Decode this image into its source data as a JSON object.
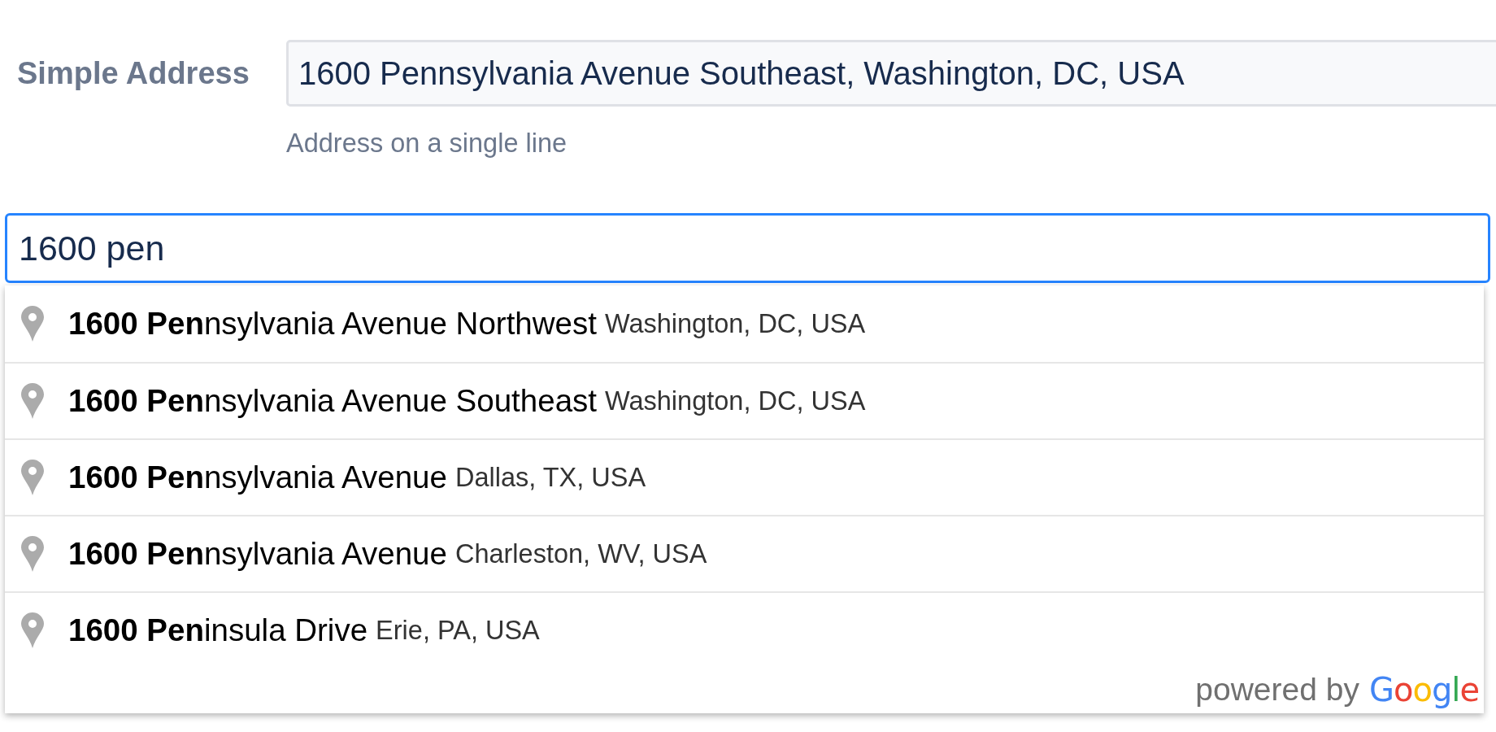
{
  "form": {
    "label": "Simple Address",
    "value": "1600 Pennsylvania Avenue Southeast, Washington, DC, USA",
    "hint": "Address on a single line"
  },
  "search": {
    "value": "1600 pen",
    "focused": true
  },
  "suggestions": [
    {
      "main": "**1600 Pen**nsylvania Avenue Northwest",
      "secondary": "Washington, DC, USA",
      "selected": false
    },
    {
      "main": "**1600 Pen**nsylvania Avenue Southeast",
      "secondary": "Washington, DC, USA",
      "selected": false
    },
    {
      "main": "**1600 Pen**nsylvania Avenue",
      "secondary": "Dallas, TX, USA",
      "selected": false
    },
    {
      "main": "**1600 Pen**nsylvania Avenue",
      "secondary": "Charleston, WV, USA",
      "selected": false
    },
    {
      "main": "**1600 Pen**insula Drive",
      "secondary": "Erie, PA, USA",
      "selected": false
    }
  ],
  "attribution": {
    "text": "powered by",
    "logo": "Google"
  }
}
